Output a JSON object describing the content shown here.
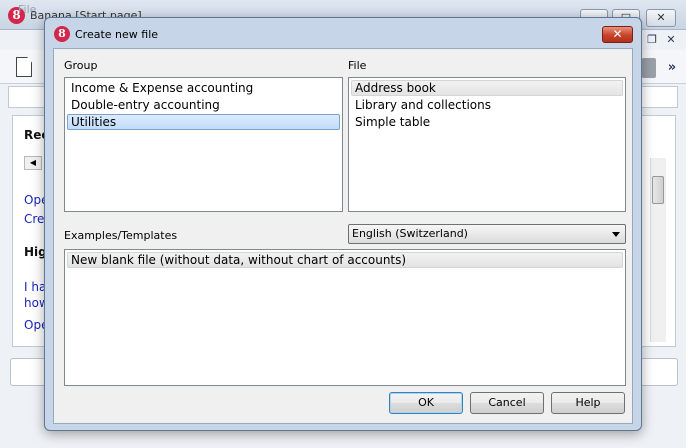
{
  "background": {
    "title": "Banana [Start page]",
    "menu_file": "File",
    "maximize_symbol": "□",
    "close_symbol": "✕",
    "restore_symbol": "❐",
    "chevron_symbol": "»",
    "panel_texts": {
      "rec": "Rec",
      "ope1": "Ope",
      "cre": "Cre",
      "high": "High",
      "i_ha": "I ha",
      "how": "how",
      "ope2": "Ope"
    }
  },
  "dialog": {
    "title": "Create new file",
    "close_symbol": "✕",
    "group": {
      "label": "Group",
      "items": [
        {
          "label": "Income & Expense accounting"
        },
        {
          "label": "Double-entry accounting"
        },
        {
          "label": "Utilities"
        }
      ],
      "selected_index": 2
    },
    "file": {
      "label": "File",
      "items": [
        {
          "label": "Address book"
        },
        {
          "label": "Library and collections"
        },
        {
          "label": "Simple table"
        }
      ],
      "highlighted_index": 0
    },
    "templates": {
      "label": "Examples/Templates",
      "items": [
        {
          "label": "New blank file (without data, without chart of accounts)"
        }
      ]
    },
    "language": {
      "selected": "English (Switzerland)"
    },
    "buttons": {
      "ok": "OK",
      "cancel": "Cancel",
      "help": "Help"
    }
  },
  "colors": {
    "dialog_frame": "#c6d5e8",
    "selection": "#c1dcfc",
    "link": "#1a24b8",
    "close_button": "#c7432a",
    "app_icon": "#d2264a"
  },
  "icons": {
    "app_icon": "banana-logo-icon",
    "doc": "new-document-icon",
    "dialog_close": "close-icon",
    "combo_arrow": "chevron-down-icon"
  }
}
